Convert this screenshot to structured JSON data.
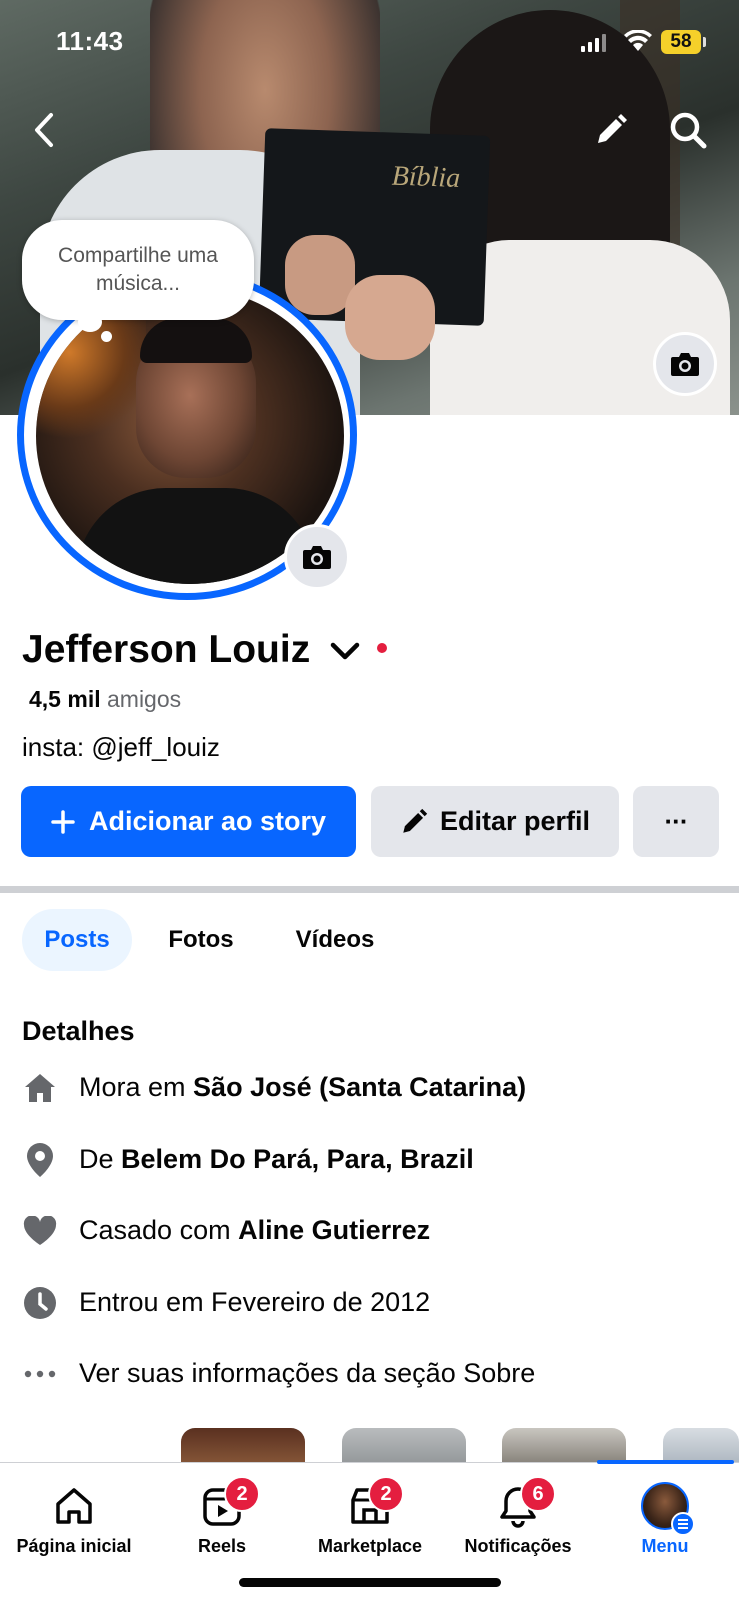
{
  "status_bar": {
    "time": "11:43",
    "battery": "58"
  },
  "cover": {
    "book_title": "Bíblia"
  },
  "music_bubble": {
    "text": "Compartilhe uma música..."
  },
  "profile": {
    "name": "Jefferson Louiz",
    "friends_count": "4,5 mil",
    "friends_label": "amigos",
    "bio": "insta: @jeff_louiz"
  },
  "actions": {
    "add_story": "Adicionar ao story",
    "edit_profile": "Editar perfil",
    "more": "···"
  },
  "tabs": [
    {
      "label": "Posts",
      "active": true
    },
    {
      "label": "Fotos",
      "active": false
    },
    {
      "label": "Vídeos",
      "active": false
    }
  ],
  "details": {
    "title": "Detalhes",
    "items": [
      {
        "icon": "home-icon",
        "prefix": "Mora em",
        "value": "São José (Santa Catarina)"
      },
      {
        "icon": "location-pin-icon",
        "prefix": "De",
        "value": "Belem Do Pará, Para, Brazil"
      },
      {
        "icon": "heart-icon",
        "prefix": "Casado com",
        "value": "Aline Gutierrez"
      },
      {
        "icon": "clock-icon",
        "prefix": "Entrou em Fevereiro de 2012",
        "value": ""
      },
      {
        "icon": "more-horizontal-icon",
        "prefix": "Ver suas informações da seção Sobre",
        "value": ""
      }
    ]
  },
  "bottom_nav": [
    {
      "label": "Página inicial",
      "icon": "home-icon",
      "badge": null
    },
    {
      "label": "Reels",
      "icon": "reels-icon",
      "badge": "2"
    },
    {
      "label": "Marketplace",
      "icon": "marketplace-icon",
      "badge": "2"
    },
    {
      "label": "Notificações",
      "icon": "bell-icon",
      "badge": "6"
    },
    {
      "label": "Menu",
      "icon": "avatar-menu-icon",
      "badge": null,
      "active": true
    }
  ],
  "colors": {
    "primary": "#0866ff",
    "badge": "#e41e3f",
    "secondary_button": "#e4e6eb",
    "active_tab_bg": "#ebf5ff"
  }
}
